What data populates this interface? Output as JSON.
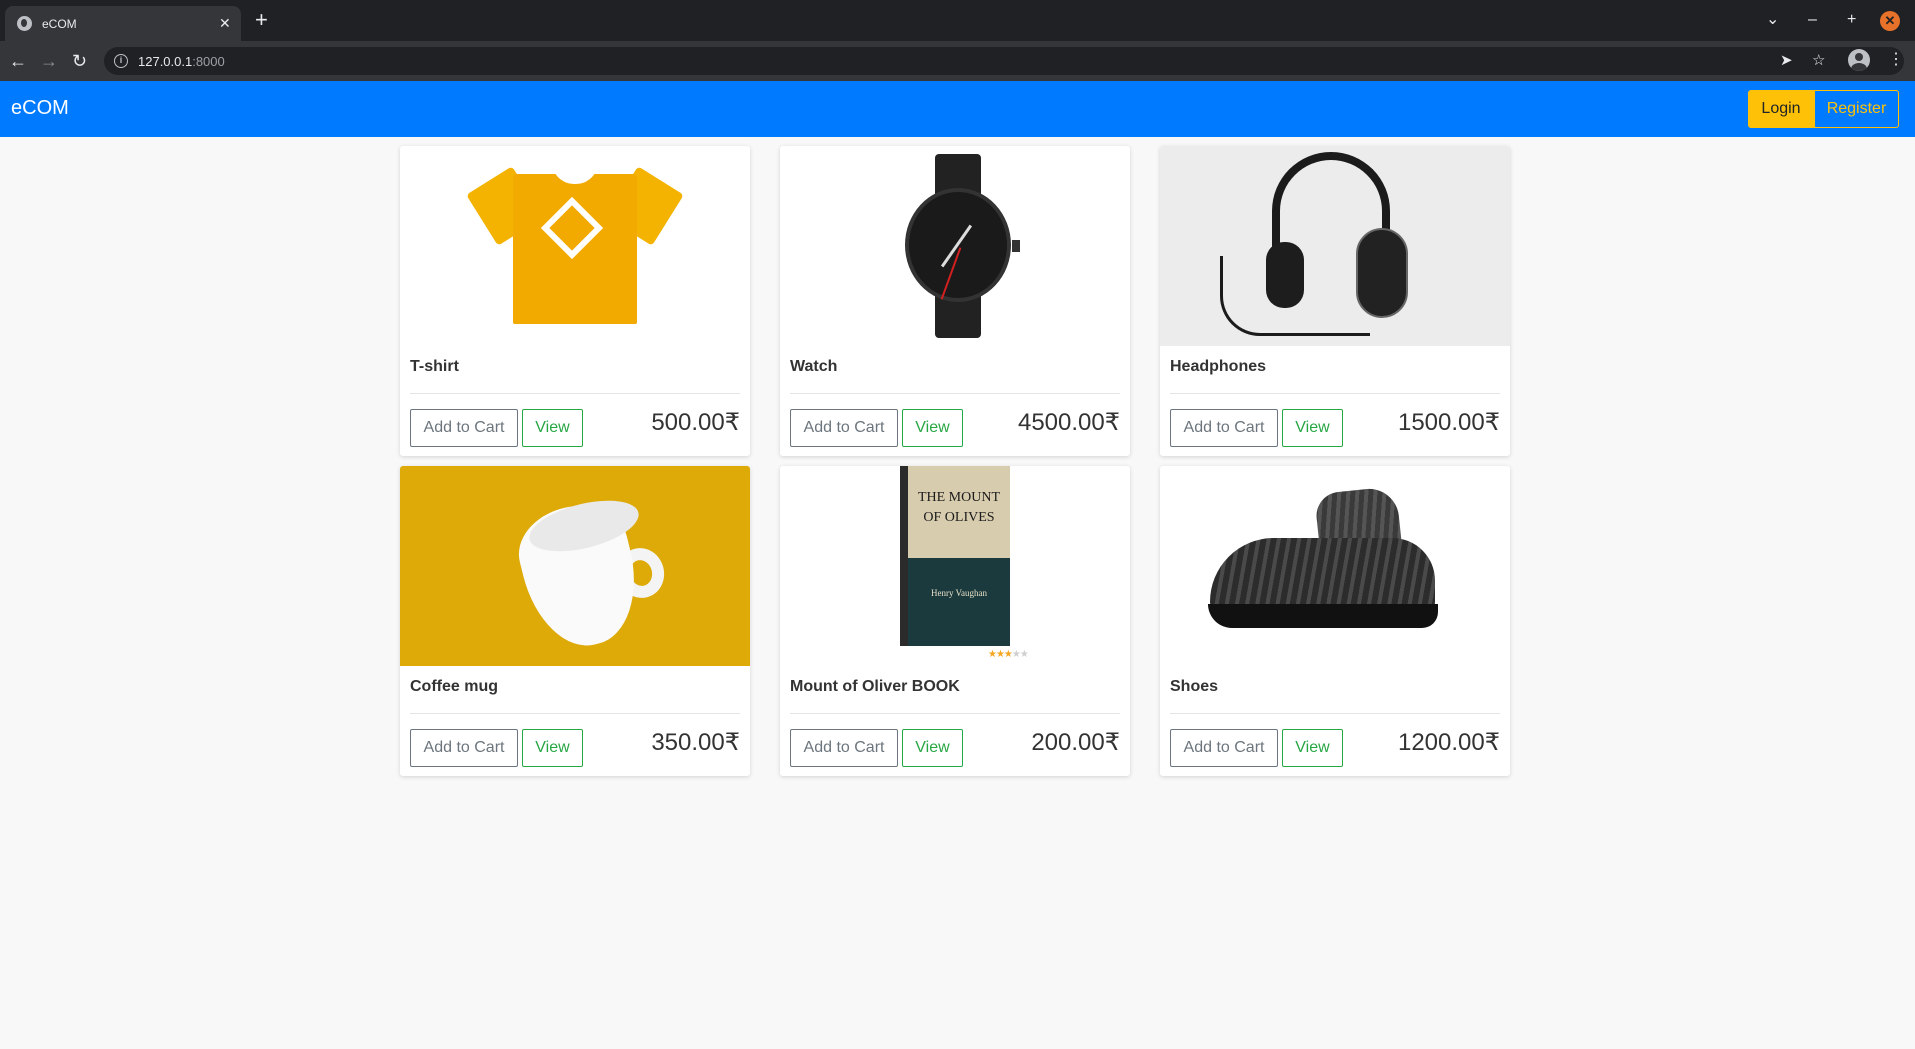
{
  "browser": {
    "tab_title": "eCOM",
    "tab_close": "✕",
    "new_tab": "+",
    "url_host": "127.0.0.1",
    "url_port": ":8000",
    "controls": {
      "chevron": "⌄",
      "minimize": "–",
      "maximize": "+",
      "close": "✕"
    },
    "nav": {
      "back": "←",
      "forward": "→",
      "reload": "↻"
    },
    "omni_icons": {
      "send": "➤",
      "star": "☆"
    },
    "menu": "⋮"
  },
  "navbar": {
    "brand": "eCOM",
    "login_label": "Login",
    "register_label": "Register",
    "colors": {
      "primary": "#007bff",
      "warning": "#ffc107"
    }
  },
  "products": [
    {
      "name": "T-shirt",
      "price": "500.00₹",
      "add_label": "Add to Cart",
      "view_label": "View",
      "image": "tshirt"
    },
    {
      "name": "Watch",
      "price": "4500.00₹",
      "add_label": "Add to Cart",
      "view_label": "View",
      "image": "watch"
    },
    {
      "name": "Headphones",
      "price": "1500.00₹",
      "add_label": "Add to Cart",
      "view_label": "View",
      "image": "headphones"
    },
    {
      "name": "Coffee mug",
      "price": "350.00₹",
      "add_label": "Add to Cart",
      "view_label": "View",
      "image": "mug"
    },
    {
      "name": "Mount of Oliver BOOK",
      "price": "200.00₹",
      "add_label": "Add to Cart",
      "view_label": "View",
      "image": "book"
    },
    {
      "name": "Shoes",
      "price": "1200.00₹",
      "add_label": "Add to Cart",
      "view_label": "View",
      "image": "shoes"
    }
  ],
  "book_cover": {
    "title": "THE MOUNT OF OLIVES",
    "author": "Henry Vaughan",
    "stars": "★★★",
    "stars_off": "★★"
  }
}
